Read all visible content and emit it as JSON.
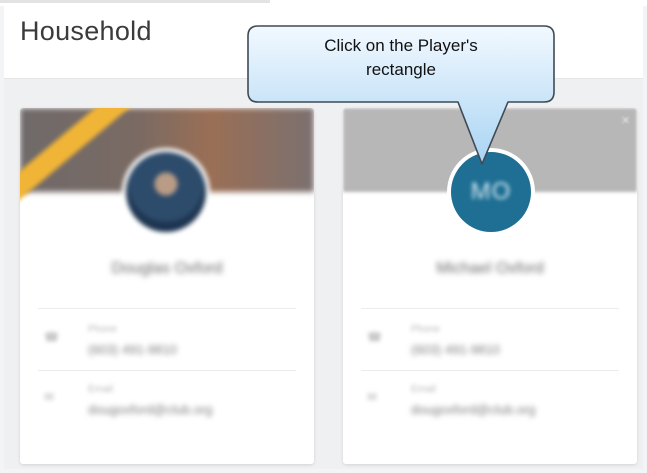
{
  "header": {
    "title": "Household"
  },
  "callout": {
    "line1": "Click on the Player's",
    "line2": "rectangle"
  },
  "players": [
    {
      "name": "Douglas Oxford",
      "phone_label": "Phone",
      "phone": "(603) 491-9810",
      "email_label": "Email",
      "email": "dougoxford@club.org"
    },
    {
      "initials": "MO",
      "name": "Michael Oxford",
      "phone_label": "Phone",
      "phone": "(603) 491-9810",
      "email_label": "Email",
      "email": "dougoxford@club.org"
    }
  ],
  "colors": {
    "avatar_blue": "#1e6f93",
    "ribbon": "#f0b437",
    "callout_fill": "#bfe0f7",
    "callout_stroke": "#3f4a55"
  }
}
